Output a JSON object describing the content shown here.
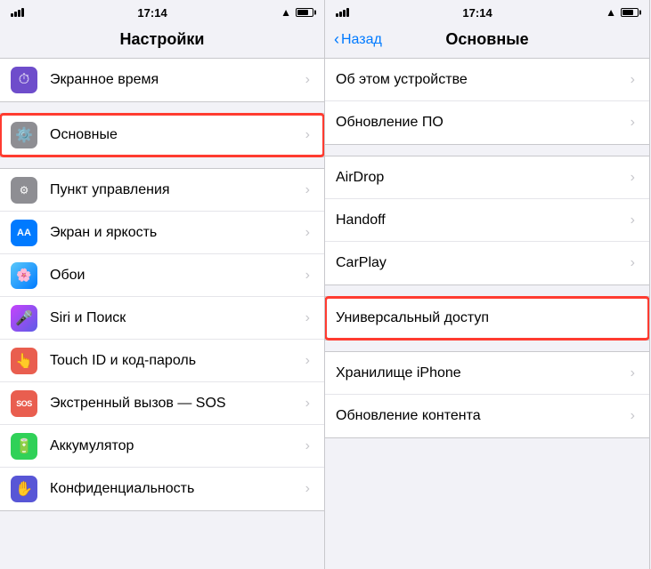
{
  "left_panel": {
    "status": {
      "signal": "●●●●",
      "wifi": "wifi",
      "time": "17:14",
      "battery": "75"
    },
    "title": "Настройки",
    "items": [
      {
        "id": "screen-time",
        "label": "Экранное время",
        "icon_bg": "#6e4dcb",
        "icon": "⏱",
        "highlighted": false
      },
      {
        "id": "general",
        "label": "Основные",
        "icon_bg": "#8e8e93",
        "icon": "⚙️",
        "highlighted": true
      },
      {
        "id": "control-center",
        "label": "Пункт управления",
        "icon_bg": "#8e8e93",
        "icon": "🎛",
        "highlighted": false
      },
      {
        "id": "display",
        "label": "Экран и яркость",
        "icon_bg": "#007aff",
        "icon": "AA",
        "highlighted": false
      },
      {
        "id": "wallpaper",
        "label": "Обои",
        "icon_bg": "#007aff",
        "icon": "🌸",
        "highlighted": false
      },
      {
        "id": "siri",
        "label": "Siri и Поиск",
        "icon_bg": "#c643fc",
        "icon": "🎤",
        "highlighted": false
      },
      {
        "id": "touch-id",
        "label": "Touch ID и код-пароль",
        "icon_bg": "#e95e4f",
        "icon": "👆",
        "highlighted": false
      },
      {
        "id": "sos",
        "label": "Экстренный вызов — SOS",
        "icon_bg": "#e95e4f",
        "icon": "SOS",
        "highlighted": false
      },
      {
        "id": "battery",
        "label": "Аккумулятор",
        "icon_bg": "#30d158",
        "icon": "🔋",
        "highlighted": false
      },
      {
        "id": "privacy",
        "label": "Конфиденциальность",
        "icon_bg": "#5856d6",
        "icon": "✋",
        "highlighted": false
      }
    ]
  },
  "right_panel": {
    "status": {
      "signal": "●●●●",
      "wifi": "wifi",
      "time": "17:14",
      "battery": "75"
    },
    "back_label": "Назад",
    "title": "Основные",
    "sections": [
      {
        "items": [
          {
            "id": "about",
            "label": "Об этом устройстве",
            "has_chevron": true,
            "highlighted": false
          },
          {
            "id": "update",
            "label": "Обновление ПО",
            "has_chevron": true,
            "highlighted": false
          }
        ]
      },
      {
        "items": [
          {
            "id": "airdrop",
            "label": "AirDrop",
            "has_chevron": true,
            "highlighted": false
          },
          {
            "id": "handoff",
            "label": "Handoff",
            "has_chevron": true,
            "highlighted": false
          },
          {
            "id": "carplay",
            "label": "CarPlay",
            "has_chevron": true,
            "highlighted": false
          }
        ]
      },
      {
        "items": [
          {
            "id": "accessibility",
            "label": "Универсальный доступ",
            "has_chevron": false,
            "highlighted": true
          }
        ]
      },
      {
        "items": [
          {
            "id": "iphone-storage",
            "label": "Хранилище iPhone",
            "has_chevron": true,
            "highlighted": false
          },
          {
            "id": "bg-refresh",
            "label": "Обновление контента",
            "has_chevron": true,
            "highlighted": false
          }
        ]
      }
    ]
  }
}
